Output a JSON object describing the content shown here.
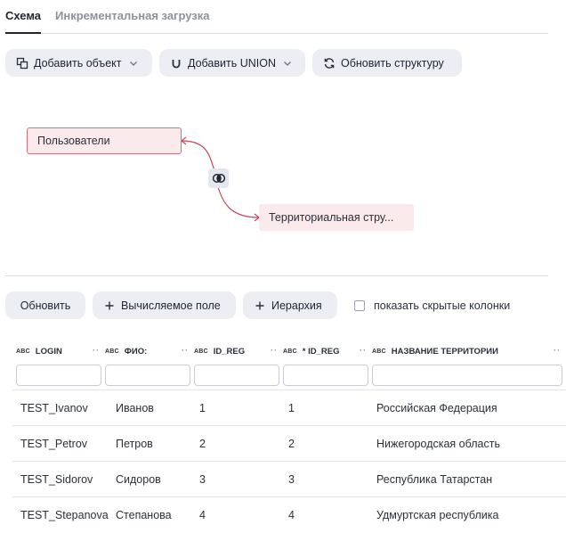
{
  "tabs": [
    {
      "label": "Схема",
      "active": true
    },
    {
      "label": "Инкрементальная загрузка",
      "active": false
    }
  ],
  "toolbar": {
    "add_object": "Добавить объект",
    "add_union": "Добавить UNION",
    "refresh_structure": "Обновить структуру"
  },
  "schema": {
    "nodes": [
      {
        "label": "Пользователи"
      },
      {
        "label": "Территориальная стру..."
      }
    ],
    "join_icon": "join-intersect-icon"
  },
  "actions": {
    "refresh": "Обновить",
    "computed_field": "Вычисляемое поле",
    "hierarchy": "Иерархия",
    "show_hidden": "показать скрытые колонки"
  },
  "table": {
    "type_tag": "ABC",
    "columns": [
      {
        "label": "LOGIN"
      },
      {
        "label": "ФИО:"
      },
      {
        "label": "ID_REG"
      },
      {
        "label": "* ID_REG"
      },
      {
        "label": "НАЗВАНИЕ ТЕРРИТОРИИ"
      }
    ],
    "rows": [
      [
        "TEST_Ivanov",
        "Иванов",
        "1",
        "1",
        "Российская Федерация"
      ],
      [
        "TEST_Petrov",
        "Петров",
        "2",
        "2",
        "Нижегородская область"
      ],
      [
        "TEST_Sidorov",
        "Сидоров",
        "3",
        "3",
        "Республика Татарстан"
      ],
      [
        "TEST_Stepanova",
        "Степанова",
        "4",
        "4",
        "Удмуртская республика"
      ]
    ]
  },
  "colors": {
    "node_border": "#d7707d",
    "node_fill": "#fbeaec",
    "button_bg": "#eceef3",
    "link": "#c8465a"
  }
}
